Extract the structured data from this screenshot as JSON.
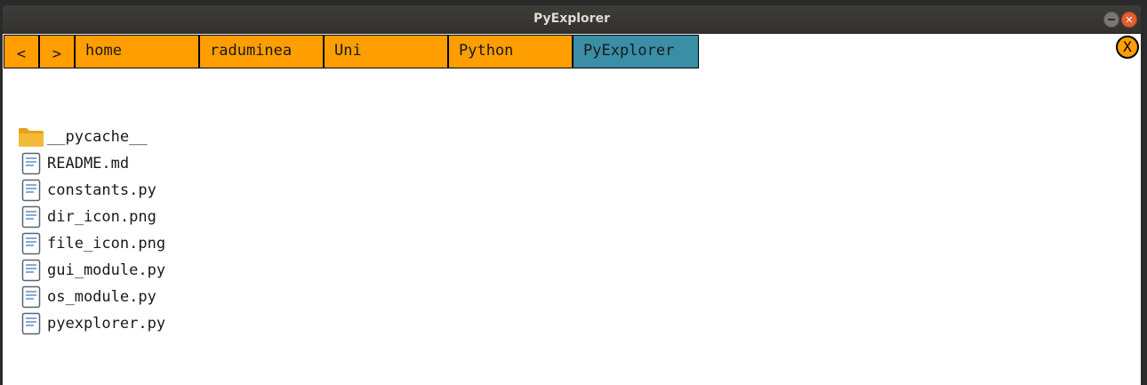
{
  "window": {
    "title": "PyExplorer"
  },
  "pathbar": {
    "back_label": "<",
    "forward_label": ">",
    "crumbs": [
      "home",
      "raduminea",
      "Uni",
      "Python",
      "PyExplorer"
    ]
  },
  "close_button_label": "X",
  "files": [
    {
      "name": "__pycache__",
      "icon": "folder-icon"
    },
    {
      "name": "README.md",
      "icon": "file-icon"
    },
    {
      "name": "constants.py",
      "icon": "file-icon"
    },
    {
      "name": "dir_icon.png",
      "icon": "file-icon"
    },
    {
      "name": "file_icon.png",
      "icon": "file-icon"
    },
    {
      "name": "gui_module.py",
      "icon": "file-icon"
    },
    {
      "name": "os_module.py",
      "icon": "file-icon"
    },
    {
      "name": "pyexplorer.py",
      "icon": "file-icon"
    }
  ],
  "colors": {
    "crumb": "#fe9e00",
    "crumb_current": "#3a8ea6",
    "titlebar": "#3a3935"
  }
}
